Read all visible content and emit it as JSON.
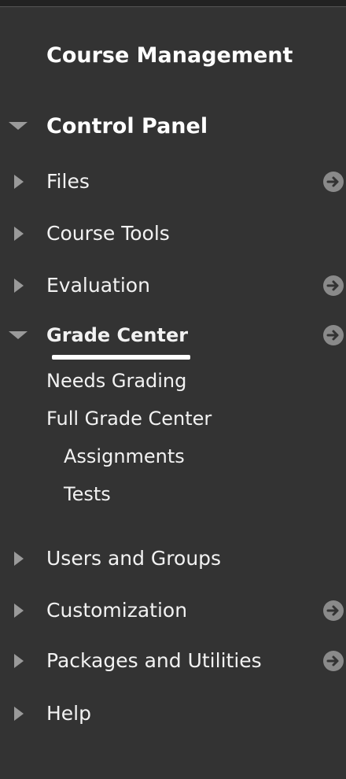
{
  "panel": {
    "section_title": "Course Management",
    "control_panel_label": "Control Panel"
  },
  "menu": {
    "files": "Files",
    "course_tools": "Course Tools",
    "evaluation": "Evaluation",
    "grade_center": "Grade Center",
    "needs_grading": "Needs Grading",
    "full_grade_center": "Full Grade Center",
    "assignments": "Assignments",
    "tests": "Tests",
    "users_and_groups": "Users and Groups",
    "customization": "Customization",
    "packages_and_utilities": "Packages and Utilities",
    "help": "Help"
  },
  "colors": {
    "background": "#333333",
    "text": "#ffffff",
    "icon": "#9a9a9a"
  }
}
